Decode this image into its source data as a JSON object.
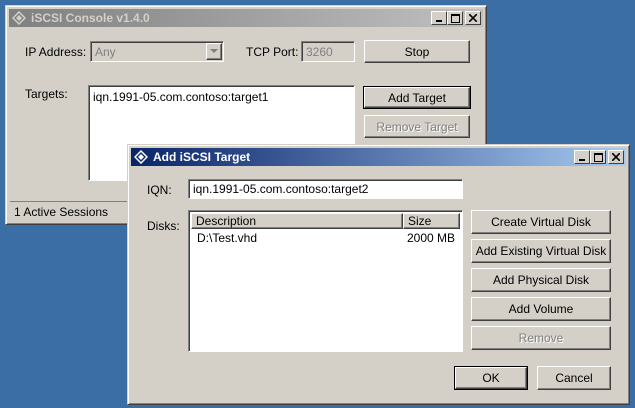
{
  "main_window": {
    "title": "iSCSI Console v1.4.0",
    "ip_label": "IP Address:",
    "ip_value": "Any",
    "tcp_label": "TCP Port:",
    "tcp_value": "3260",
    "stop_label": "Stop",
    "targets_label": "Targets:",
    "targets": [
      "iqn.1991-05.com.contoso:target1"
    ],
    "add_target_label": "Add Target",
    "remove_target_label": "Remove Target",
    "status": "1 Active Sessions"
  },
  "dialog": {
    "title": "Add iSCSI Target",
    "iqn_label": "IQN:",
    "iqn_value": "iqn.1991-05.com.contoso:target2",
    "disks_label": "Disks:",
    "columns": {
      "description": "Description",
      "size": "Size"
    },
    "disks": [
      {
        "description": "D:\\Test.vhd",
        "size": "2000 MB"
      }
    ],
    "buttons": {
      "create_virtual_disk": "Create Virtual Disk",
      "add_existing_virtual_disk": "Add Existing Virtual Disk",
      "add_physical_disk": "Add Physical Disk",
      "add_volume": "Add Volume",
      "remove": "Remove",
      "ok": "OK",
      "cancel": "Cancel"
    }
  },
  "icons": {
    "app": "diamond-app-icon",
    "minimize": "minimize-icon",
    "maximize": "maximize-icon",
    "close": "close-icon",
    "dropdown": "chevron-down-icon"
  }
}
